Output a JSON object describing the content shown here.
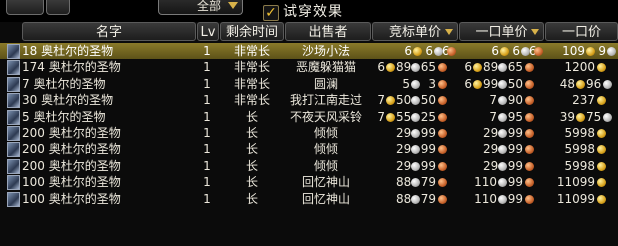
{
  "filter": {
    "category_value": "全部"
  },
  "tryon": {
    "checked_mark": "✓",
    "label": "试穿效果"
  },
  "headers": {
    "name": "名字",
    "level": "Lv",
    "time_left": "剩余时间",
    "seller": "出售者",
    "bid_unit": "竞标单价",
    "buyout_unit": "一口单价",
    "buyout": "一口价"
  },
  "rows": [
    {
      "name": "18 奥杜尔的圣物",
      "level": "1",
      "time_left": "非常长",
      "seller": "沙场小法",
      "bid": [
        "6",
        "6",
        "6"
      ],
      "buy": [
        "6",
        "6",
        "6"
      ],
      "buyout": [
        "109",
        "9",
        ""
      ]
    },
    {
      "name": "174 奥杜尔的圣物",
      "level": "1",
      "time_left": "非常长",
      "seller": "恶魔躲猫猫",
      "bid": [
        "6",
        "89",
        "65"
      ],
      "buy": [
        "6",
        "89",
        "65"
      ],
      "buyout": [
        "1200",
        "",
        ""
      ]
    },
    {
      "name": "7 奥杜尔的圣物",
      "level": "1",
      "time_left": "非常长",
      "seller": "圆澜",
      "bid": [
        "",
        "5",
        "3"
      ],
      "buy": [
        "6",
        "99",
        "50"
      ],
      "buyout": [
        "48",
        "96",
        ""
      ]
    },
    {
      "name": "30 奥杜尔的圣物",
      "level": "1",
      "time_left": "非常长",
      "seller": "我打江南走过",
      "bid": [
        "7",
        "50",
        "50"
      ],
      "buy": [
        "",
        "7",
        "90"
      ],
      "buyout": [
        "237",
        "",
        ""
      ]
    },
    {
      "name": "5 奥杜尔的圣物",
      "level": "1",
      "time_left": "长",
      "seller": "不夜天风采铃",
      "bid": [
        "7",
        "55",
        "25"
      ],
      "buy": [
        "",
        "7",
        "95"
      ],
      "buyout": [
        "39",
        "75",
        ""
      ]
    },
    {
      "name": "200 奥杜尔的圣物",
      "level": "1",
      "time_left": "长",
      "seller": "倾倾",
      "bid": [
        "",
        "29",
        "99"
      ],
      "buy": [
        "",
        "29",
        "99"
      ],
      "buyout": [
        "5998",
        "",
        ""
      ]
    },
    {
      "name": "200 奥杜尔的圣物",
      "level": "1",
      "time_left": "长",
      "seller": "倾倾",
      "bid": [
        "",
        "29",
        "99"
      ],
      "buy": [
        "",
        "29",
        "99"
      ],
      "buyout": [
        "5998",
        "",
        ""
      ]
    },
    {
      "name": "200 奥杜尔的圣物",
      "level": "1",
      "time_left": "长",
      "seller": "倾倾",
      "bid": [
        "",
        "29",
        "99"
      ],
      "buy": [
        "",
        "29",
        "99"
      ],
      "buyout": [
        "5998",
        "",
        ""
      ]
    },
    {
      "name": "100 奥杜尔的圣物",
      "level": "1",
      "time_left": "长",
      "seller": "回忆神山",
      "bid": [
        "",
        "88",
        "79"
      ],
      "buy": [
        "",
        "110",
        "99"
      ],
      "buyout": [
        "11099",
        "",
        ""
      ]
    },
    {
      "name": "100 奥杜尔的圣物",
      "level": "1",
      "time_left": "长",
      "seller": "回忆神山",
      "bid": [
        "",
        "88",
        "79"
      ],
      "buy": [
        "",
        "110",
        "99"
      ],
      "buyout": [
        "11099",
        "",
        ""
      ]
    }
  ],
  "selected_row": 0
}
